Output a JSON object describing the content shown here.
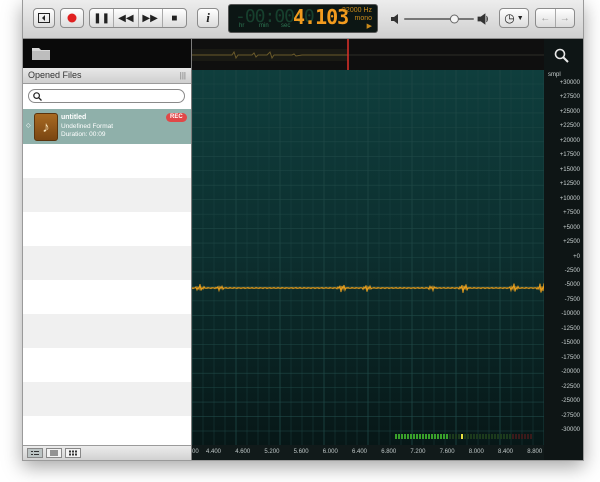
{
  "toolbar": {
    "counter_ghost": "-00:00:0",
    "seconds": "4.103",
    "unit_hr": "hr",
    "unit_min": "min",
    "unit_sec": "sec",
    "sample_rate": "32000 Hz",
    "channels": "mono",
    "play_state": "▶",
    "volume_level": 0.72
  },
  "sidebar": {
    "section_title": "Opened Files",
    "search_placeholder": "",
    "files": [
      {
        "name": "untitled",
        "format": "Undefined Format",
        "duration": "Duration: 00:09",
        "badge": "REC"
      }
    ]
  },
  "ruler": {
    "unit": "smpl",
    "labels": [
      "+30000",
      "+27500",
      "+25000",
      "+22500",
      "+20000",
      "+17500",
      "+15000",
      "+12500",
      "+10000",
      "+7500",
      "+5000",
      "+2500",
      "+0",
      "-2500",
      "-5000",
      "-7500",
      "-10000",
      "-12500",
      "-15000",
      "-17500",
      "-20000",
      "-22500",
      "-25000",
      "-27500",
      "-30000"
    ]
  },
  "timeline": {
    "labels": [
      "00",
      "4.400",
      "4.600",
      "5.200",
      "5.600",
      "6.000",
      "6.400",
      "6.800",
      "7.200",
      "7.600",
      "8.000",
      "8.400",
      "8.800"
    ]
  },
  "colors": {
    "waveform": "#f0a21c",
    "playhead": "#e0302a",
    "lcd_digits": "#f29b1e",
    "grid": "#1f4846",
    "selection": "#8fb0aa",
    "rec_badge": "#e04848"
  }
}
